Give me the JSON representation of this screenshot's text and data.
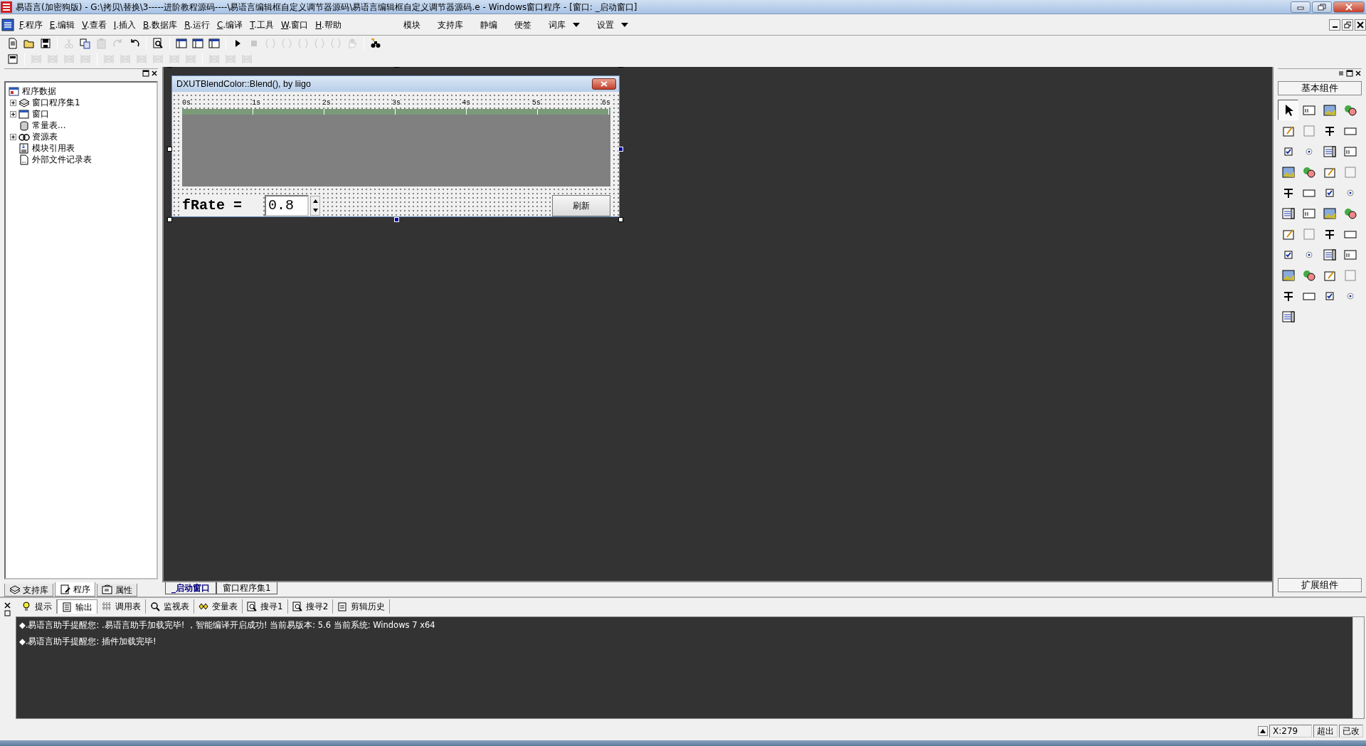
{
  "window": {
    "title": "易语言(加密狗版) - G:\\拷贝\\替换\\3-----进阶教程源码----\\易语言编辑框自定义调节器源码\\易语言编辑框自定义调节器源码.e - Windows窗口程序 - [窗口: _启动窗口]"
  },
  "menu": [
    {
      "label": "F.程序"
    },
    {
      "label": "E.编辑"
    },
    {
      "label": "V.查看"
    },
    {
      "label": "I.插入"
    },
    {
      "label": "B.数据库"
    },
    {
      "label": "R.运行"
    },
    {
      "label": "C.编译"
    },
    {
      "label": "T.工具"
    },
    {
      "label": "W.窗口"
    },
    {
      "label": "H.帮助"
    }
  ],
  "menu_right": [
    {
      "label": "模块",
      "dropdown": false
    },
    {
      "label": "支持库",
      "dropdown": false
    },
    {
      "label": "静编",
      "dropdown": false
    },
    {
      "label": "便签",
      "dropdown": false
    },
    {
      "label": "词库",
      "dropdown": true
    },
    {
      "label": "设置",
      "dropdown": true
    }
  ],
  "toolbar": [
    {
      "kind": "new",
      "disabled": false
    },
    {
      "kind": "open",
      "disabled": false
    },
    {
      "kind": "save",
      "disabled": false
    },
    {
      "kind": "sep"
    },
    {
      "kind": "cut",
      "disabled": true
    },
    {
      "kind": "copy",
      "disabled": false
    },
    {
      "kind": "paste",
      "disabled": true
    },
    {
      "kind": "redo",
      "disabled": true
    },
    {
      "kind": "undo",
      "disabled": false
    },
    {
      "kind": "sep"
    },
    {
      "kind": "preview",
      "disabled": false
    },
    {
      "kind": "sep"
    },
    {
      "kind": "layout",
      "disabled": false
    },
    {
      "kind": "layout",
      "disabled": false
    },
    {
      "kind": "layout",
      "disabled": false
    },
    {
      "kind": "sep"
    },
    {
      "kind": "run",
      "disabled": false
    },
    {
      "kind": "stop",
      "disabled": true
    },
    {
      "kind": "step",
      "disabled": true
    },
    {
      "kind": "step",
      "disabled": true
    },
    {
      "kind": "step",
      "disabled": true
    },
    {
      "kind": "step",
      "disabled": true
    },
    {
      "kind": "step",
      "disabled": true
    },
    {
      "kind": "hand",
      "disabled": true
    },
    {
      "kind": "sep"
    },
    {
      "kind": "binoculars",
      "disabled": false
    }
  ],
  "toolbar2": [
    {
      "kind": "form",
      "disabled": false
    },
    {
      "kind": "sep"
    },
    {
      "kind": "align",
      "disabled": true
    },
    {
      "kind": "align",
      "disabled": true
    },
    {
      "kind": "align",
      "disabled": true
    },
    {
      "kind": "align",
      "disabled": true
    },
    {
      "kind": "sep"
    },
    {
      "kind": "align",
      "disabled": true
    },
    {
      "kind": "align",
      "disabled": true
    },
    {
      "kind": "align",
      "disabled": true
    },
    {
      "kind": "align",
      "disabled": true
    },
    {
      "kind": "align",
      "disabled": true
    },
    {
      "kind": "align",
      "disabled": true
    },
    {
      "kind": "sep"
    },
    {
      "kind": "align",
      "disabled": true
    },
    {
      "kind": "align",
      "disabled": true
    },
    {
      "kind": "align",
      "disabled": true
    }
  ],
  "tree": {
    "label": "程序数据",
    "children": [
      {
        "label": "窗口程序集1",
        "kind": "set",
        "expandable": true
      },
      {
        "label": "窗口",
        "kind": "window",
        "expandable": true
      },
      {
        "label": "常量表...",
        "kind": "const",
        "expandable": false
      },
      {
        "label": "资源表",
        "kind": "resource",
        "expandable": true
      },
      {
        "label": "模块引用表",
        "kind": "module",
        "expandable": false
      },
      {
        "label": "外部文件记录表",
        "kind": "file",
        "expandable": false
      }
    ]
  },
  "left_tabs": [
    {
      "label": "支持库",
      "selected": false
    },
    {
      "label": "程序",
      "selected": true
    },
    {
      "label": "属性",
      "selected": false
    }
  ],
  "designer": {
    "form_title": "DXUTBlendColor::Blend(), by liigo",
    "ruler": [
      "0s",
      "1s",
      "2s",
      "3s",
      "4s",
      "5s",
      "6s"
    ],
    "rate_label": "fRate =",
    "rate_value": "0.8",
    "refresh": "刷新"
  },
  "doc_tabs": [
    {
      "label": "_启动窗口",
      "selected": true
    },
    {
      "label": "窗口程序集1",
      "selected": false
    }
  ],
  "palette": {
    "title": "基本组件",
    "footer": "扩展组件",
    "items": [
      {
        "selected": true
      },
      {
        "selected": false
      },
      {
        "selected": false
      },
      {
        "selected": false
      },
      {
        "selected": false
      },
      {
        "selected": false
      },
      {
        "selected": false
      },
      {
        "selected": false
      },
      {
        "selected": false
      },
      {
        "selected": false
      },
      {
        "selected": false
      },
      {
        "selected": false
      },
      {
        "selected": false
      },
      {
        "selected": false
      },
      {
        "selected": false
      },
      {
        "selected": false
      },
      {
        "selected": false
      },
      {
        "selected": false
      },
      {
        "selected": false
      },
      {
        "selected": false
      },
      {
        "selected": false
      },
      {
        "selected": false
      },
      {
        "selected": false
      },
      {
        "selected": false
      },
      {
        "selected": false
      },
      {
        "selected": false
      },
      {
        "selected": false
      },
      {
        "selected": false
      },
      {
        "selected": false
      },
      {
        "selected": false
      },
      {
        "selected": false
      },
      {
        "selected": false
      },
      {
        "selected": false
      },
      {
        "selected": false
      },
      {
        "selected": false
      },
      {
        "selected": false
      },
      {
        "selected": false
      },
      {
        "selected": false
      },
      {
        "selected": false
      },
      {
        "selected": false
      },
      {
        "selected": false
      }
    ]
  },
  "output_tabs": [
    {
      "label": "提示",
      "selected": false
    },
    {
      "label": "输出",
      "selected": true
    },
    {
      "label": "调用表",
      "selected": false
    },
    {
      "label": "监视表",
      "selected": false
    },
    {
      "label": "变量表",
      "selected": false
    },
    {
      "label": "搜寻1",
      "selected": false
    },
    {
      "label": "搜寻2",
      "selected": false
    },
    {
      "label": "剪辑历史",
      "selected": false
    }
  ],
  "output_lines": [
    "◆.易语言助手提醒您: .易语言助手加载完毕! ，智能编译开启成功!  当前易版本: 5.6  当前系统: Windows 7 x64",
    "◆.易语言助手提醒您: 插件加载完毕!"
  ],
  "status": {
    "position": "X:279",
    "mode": "超出",
    "modified": "已改"
  }
}
